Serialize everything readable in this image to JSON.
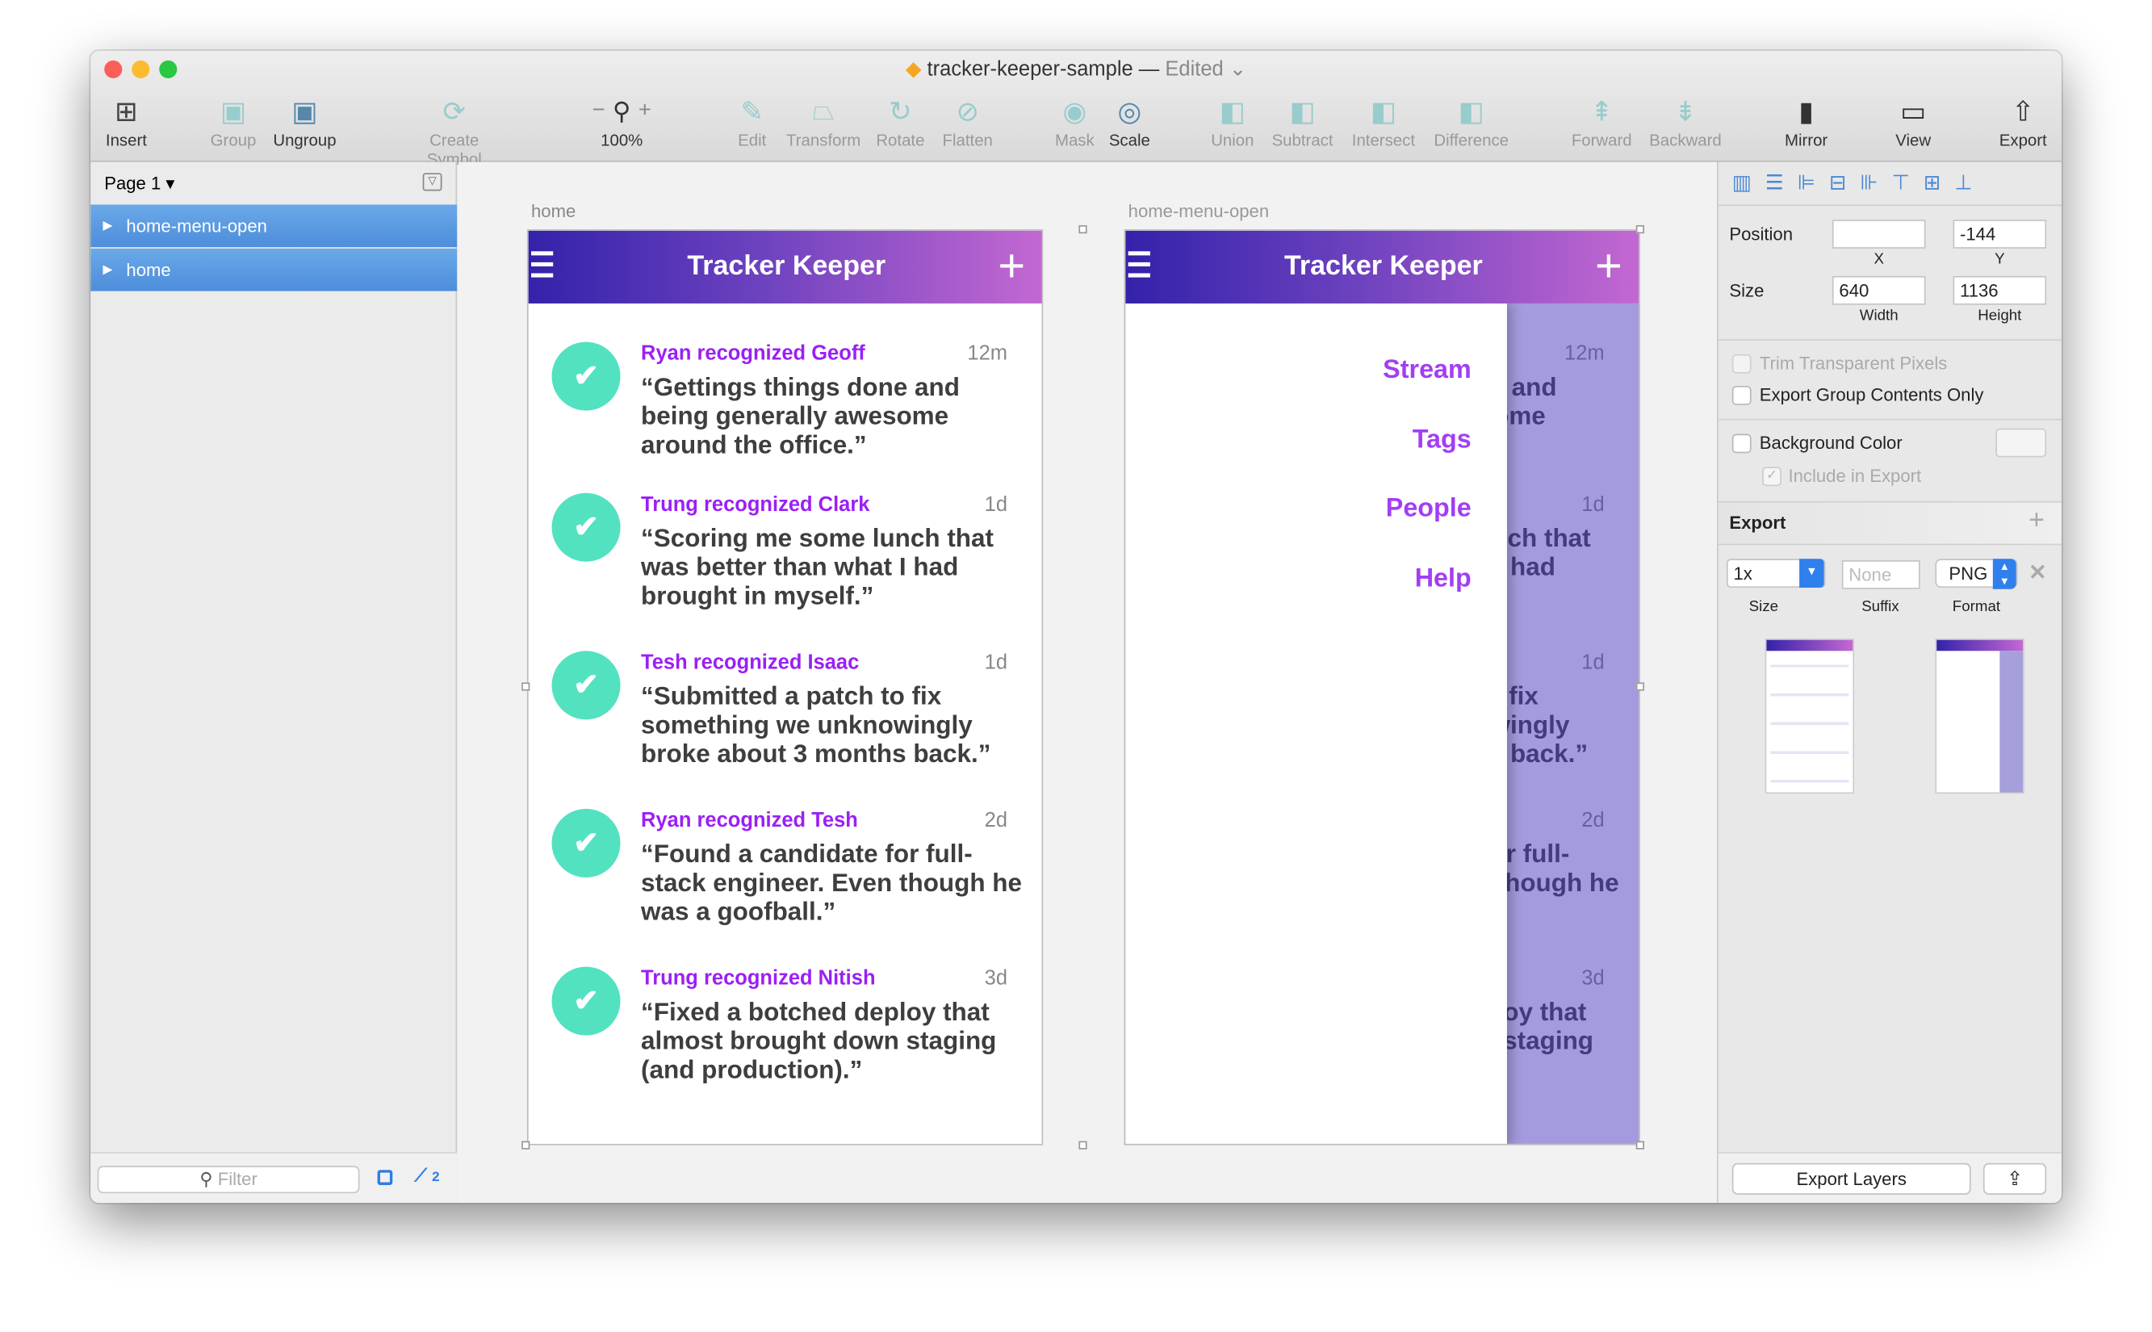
{
  "window": {
    "title": "tracker-keeper-sample",
    "separator": "—",
    "status": "Edited",
    "status_chevron": "⌄"
  },
  "toolbar": {
    "items": [
      {
        "label": "Insert",
        "icon": "insert-icon"
      },
      {
        "label": "Group",
        "icon": "group-icon"
      },
      {
        "label": "Ungroup",
        "icon": "ungroup-icon"
      },
      {
        "label": "Create Symbol",
        "icon": "symbol-icon"
      },
      {
        "label": "100%",
        "icon": "zoom-icon"
      },
      {
        "label": "Edit",
        "icon": "edit-icon"
      },
      {
        "label": "Transform",
        "icon": "transform-icon"
      },
      {
        "label": "Rotate",
        "icon": "rotate-icon"
      },
      {
        "label": "Flatten",
        "icon": "flatten-icon"
      },
      {
        "label": "Mask",
        "icon": "mask-icon"
      },
      {
        "label": "Scale",
        "icon": "scale-icon"
      },
      {
        "label": "Union",
        "icon": "union-icon"
      },
      {
        "label": "Subtract",
        "icon": "subtract-icon"
      },
      {
        "label": "Intersect",
        "icon": "intersect-icon"
      },
      {
        "label": "Difference",
        "icon": "difference-icon"
      },
      {
        "label": "Forward",
        "icon": "forward-icon"
      },
      {
        "label": "Backward",
        "icon": "backward-icon"
      },
      {
        "label": "Mirror",
        "icon": "mirror-icon"
      },
      {
        "label": "View",
        "icon": "view-icon"
      },
      {
        "label": "Export",
        "icon": "export-icon"
      }
    ],
    "zoom_minus": "−",
    "zoom_plus": "+"
  },
  "layers": {
    "page": "Page 1",
    "items": [
      {
        "label": "home-menu-open"
      },
      {
        "label": "home"
      }
    ],
    "filter_placeholder": "Filter",
    "slice_count": "2"
  },
  "artboards": {
    "home": {
      "label": "home"
    },
    "menu": {
      "label": "home-menu-open",
      "menu_items": [
        "Stream",
        "Tags",
        "People",
        "Help"
      ]
    }
  },
  "app": {
    "title": "Tracker Keeper",
    "colors": {
      "header_start": "#3322aa",
      "header_end": "#c468d2",
      "accent": "#9b1ff5",
      "check": "#52e2c0"
    },
    "feed": [
      {
        "who": "Ryan recognized Geoff",
        "ago": "12m",
        "quote": "“Gettings things done and being generally awesome around the office.”"
      },
      {
        "who": "Trung recognized Clark",
        "ago": "1d",
        "quote": "“Scoring me some lunch that was better than what I had brought in myself.”"
      },
      {
        "who": "Tesh recognized Isaac",
        "ago": "1d",
        "quote": "“Submitted a patch to fix something we unknowingly broke about 3 months back.”"
      },
      {
        "who": "Ryan recognized Tesh",
        "ago": "2d",
        "quote": "“Found a candidate for full-stack engineer. Even though he was a goofball.”"
      },
      {
        "who": "Trung recognized Nitish",
        "ago": "3d",
        "quote": "“Fixed a botched deploy that almost brought down staging (and production).”"
      }
    ]
  },
  "inspector": {
    "position_label": "Position",
    "x_value": "",
    "y_value": "-144",
    "x_caption": "X",
    "y_caption": "Y",
    "size_label": "Size",
    "width_value": "640",
    "height_value": "1136",
    "width_caption": "Width",
    "height_caption": "Height",
    "trim": "Trim Transparent Pixels",
    "group_only": "Export Group Contents Only",
    "bg_color": "Background Color",
    "include": "Include in Export",
    "export_title": "Export",
    "export_size": "1x",
    "suffix_placeholder": "None",
    "format": "PNG",
    "size_caption": "Size",
    "suffix_caption": "Suffix",
    "format_caption": "Format",
    "export_layers": "Export Layers"
  }
}
